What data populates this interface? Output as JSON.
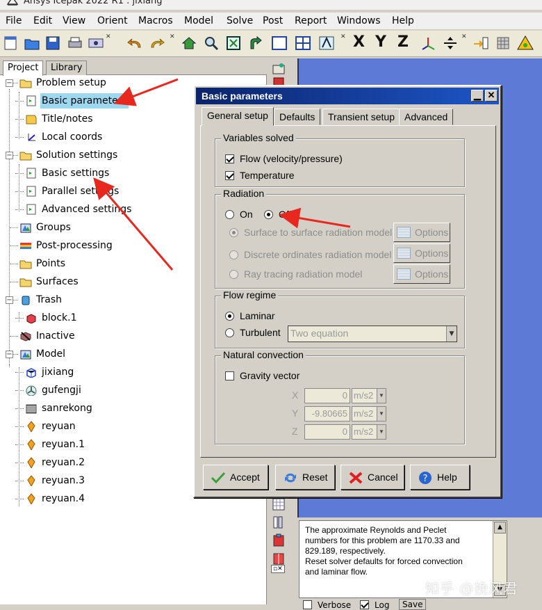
{
  "window": {
    "title": "Ansys Icepak 2022 R1 : jixiang"
  },
  "menu": [
    "File",
    "Edit",
    "View",
    "Orient",
    "Macros",
    "Model",
    "Solve",
    "Post",
    "Report",
    "Windows",
    "Help"
  ],
  "toolbar": {
    "axis_x": "X",
    "axis_y": "Y",
    "axis_z": "Z"
  },
  "left_tabs": [
    "Project",
    "Library"
  ],
  "tree": [
    "Problem setup",
    "Basic parameters",
    "Title/notes",
    "Local coords",
    "Solution settings",
    "Basic settings",
    "Parallel settings",
    "Advanced settings",
    "Groups",
    "Post-processing",
    "Points",
    "Surfaces",
    "Trash",
    "block.1",
    "Inactive",
    "Model",
    "jixiang",
    "gufengji",
    "sanrekong",
    "reyuan",
    "reyuan.1",
    "reyuan.2",
    "reyuan.3",
    "reyuan.4"
  ],
  "dialog": {
    "title": "Basic parameters",
    "tabs": [
      "General setup",
      "Defaults",
      "Transient setup",
      "Advanced"
    ],
    "variables": {
      "title": "Variables solved",
      "flow": "Flow (velocity/pressure)",
      "flow_checked": true,
      "temperature": "Temperature",
      "temperature_checked": true
    },
    "radiation": {
      "title": "Radiation",
      "on": "On",
      "off": "Off",
      "selected": "Off",
      "s2s": "Surface to surface radiation model",
      "discrete": "Discrete ordinates radiation model",
      "ray": "Ray tracing radiation model",
      "options": "Options"
    },
    "flow_regime": {
      "title": "Flow regime",
      "laminar": "Laminar",
      "turbulent": "Turbulent",
      "selected": "Laminar",
      "turb_model": "Two equation"
    },
    "natural_convection": {
      "title": "Natural convection",
      "gravity": "Gravity vector",
      "gravity_checked": false,
      "x_label": "X",
      "x_value": "0",
      "y_label": "Y",
      "y_value": "-9.80665",
      "z_label": "Z",
      "z_value": "0",
      "unit": "m/s2"
    },
    "buttons": {
      "accept": "Accept",
      "reset": "Reset",
      "cancel": "Cancel",
      "help": "Help"
    }
  },
  "message": {
    "lines": [
      "The approximate Reynolds and Peclet",
      "numbers for this problem are 1170.33 and",
      "829.189, respectively.",
      "Reset solver defaults for forced convection",
      "and laminar flow."
    ],
    "watermark": "知乎 @挽风君",
    "verbose": "Verbose",
    "log": "Log",
    "save": "Save"
  }
}
